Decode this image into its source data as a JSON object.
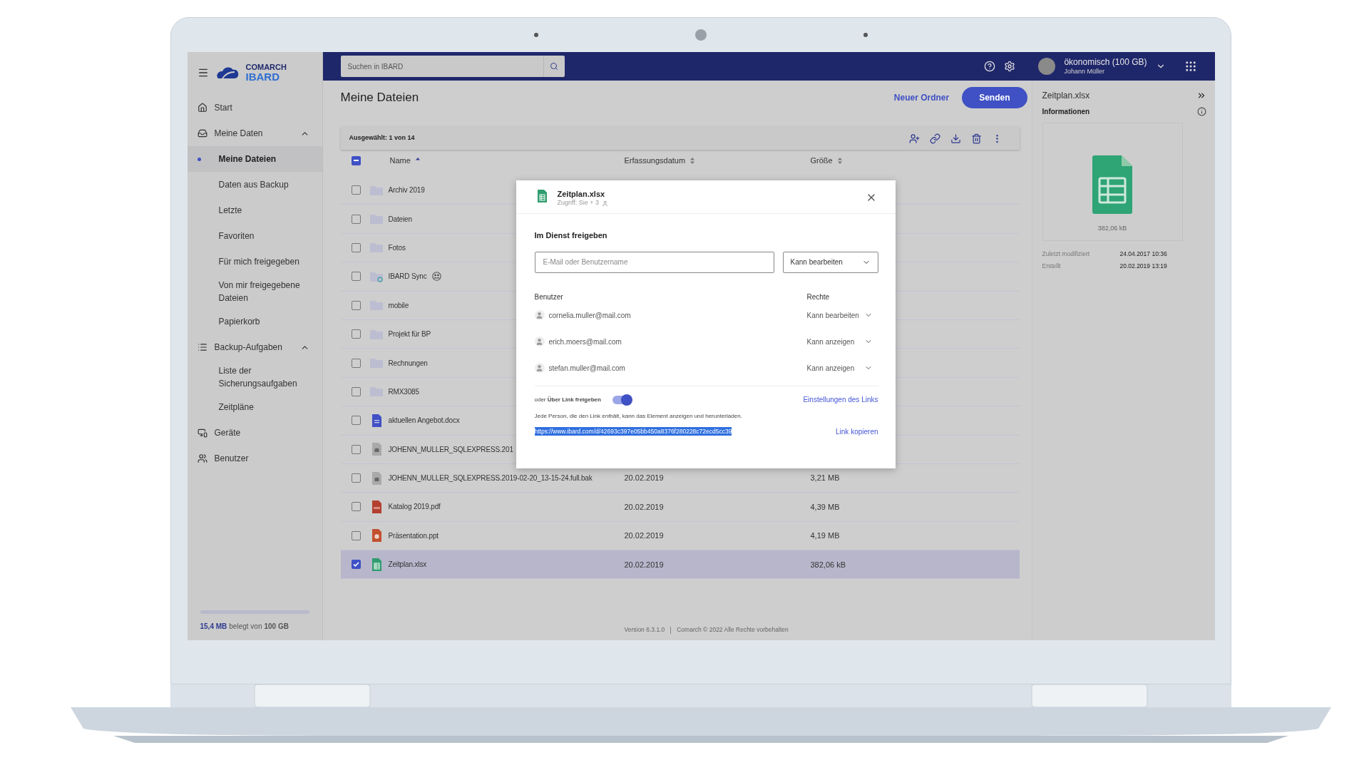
{
  "sidebar": {
    "logo_top": "COMARCH",
    "logo_bottom": "IBARD",
    "items": [
      {
        "kind": "link",
        "label": "Start"
      },
      {
        "kind": "group",
        "label": "Meine Daten",
        "expanded": true,
        "children": [
          {
            "label": "Meine Dateien",
            "selected": true
          },
          {
            "label": "Daten aus Backup",
            "selected": false
          },
          {
            "label": "Letzte",
            "selected": false
          },
          {
            "label": "Favoriten",
            "selected": false
          },
          {
            "label": "Für mich freigegeben",
            "selected": false
          },
          {
            "label": "Von mir freigegebene Dateien",
            "selected": false
          },
          {
            "label": "Papierkorb",
            "selected": false
          }
        ]
      },
      {
        "kind": "group",
        "label": "Backup-Aufgaben",
        "expanded": true,
        "children": [
          {
            "label": "Liste der Sicherungsaufgaben",
            "selected": false
          },
          {
            "label": "Zeitpläne",
            "selected": false
          }
        ]
      },
      {
        "kind": "link",
        "label": "Geräte"
      },
      {
        "kind": "link",
        "label": "Benutzer"
      }
    ],
    "storage": {
      "used": "15,4 MB",
      "text": "belegt von",
      "total": "100 GB"
    }
  },
  "topbar": {
    "search_placeholder": "Suchen in IBARD",
    "plan": "ökonomisch (100 GB)",
    "user": "Johann Müller"
  },
  "header": {
    "title": "Meine Dateien",
    "buttons": [
      {
        "label": "Neuer Ordner",
        "kind": "text"
      },
      {
        "label": "Senden",
        "kind": "primary"
      }
    ]
  },
  "toolbar": {
    "selection": "Ausgewählt: 1 von 14",
    "select_all_indeterminate": true
  },
  "table": {
    "columns": [
      {
        "label": "Name",
        "sorted": true
      },
      {
        "label": "Erfassungsdatum",
        "sorted": false
      },
      {
        "label": "Größe",
        "sorted": false
      }
    ],
    "rows": [
      {
        "kind": "folder",
        "name": "Archiv 2019",
        "selected": false
      },
      {
        "kind": "folder",
        "name": "Dateien",
        "selected": false
      },
      {
        "kind": "folder",
        "name": "Fotos",
        "selected": false
      },
      {
        "kind": "sync-folder",
        "name": "IBARD Sync",
        "selected": false
      },
      {
        "kind": "folder",
        "name": "mobile",
        "selected": false
      },
      {
        "kind": "folder",
        "name": "Projekt für BP",
        "selected": false
      },
      {
        "kind": "folder",
        "name": "Rechnungen",
        "selected": false
      },
      {
        "kind": "folder",
        "name": "RMX3085",
        "selected": false
      },
      {
        "kind": "doc",
        "name": "aktuellen Angebot.docx",
        "selected": false
      },
      {
        "kind": "bak",
        "name": "JOHENN_MULLER_SQLEXPRESS.201",
        "selected": false
      },
      {
        "kind": "bak",
        "name": "JOHENN_MULLER_SQLEXPRESS.2019-02-20_13-15-24.full.bak",
        "date": "20.02.2019",
        "size": "3,21 MB",
        "selected": false
      },
      {
        "kind": "pdf",
        "name": "Katalog 2019.pdf",
        "date": "20.02.2019",
        "size": "4,39 MB",
        "selected": false
      },
      {
        "kind": "ppt",
        "name": "Präsentation.ppt",
        "date": "20.02.2019",
        "size": "4,19 MB",
        "selected": false
      },
      {
        "kind": "xlsx",
        "name": "Zeitplan.xlsx",
        "date": "20.02.2019",
        "size": "382,06 kB",
        "selected": true
      }
    ]
  },
  "footer": {
    "version": "Version 6.3.1.0",
    "copyright": "Comarch © 2022 Alle Rechte vorbehalten"
  },
  "details": {
    "title": "Zeitplan.xlsx",
    "section": "Informationen",
    "size": "382,06 kB",
    "meta": [
      {
        "label": "Zuletzt modifiziert",
        "value": "24.04.2017 10:36"
      },
      {
        "label": "Erstellt",
        "value": "20.02.2019 13:19"
      }
    ]
  },
  "dialog": {
    "file": "Zeitplan.xlsx",
    "access": "Zugriff: Sie + 3",
    "heading": "Im Dienst freigeben",
    "email_placeholder": "E-Mail oder Benutzername",
    "role": "Kann bearbeiten",
    "users_label": "Benutzer",
    "rights_label": "Rechte",
    "users": [
      {
        "email": "cornelia.muller@mail.com",
        "right": "Kann bearbeiten"
      },
      {
        "email": "erich.moers@mail.com",
        "right": "Kann anzeigen"
      },
      {
        "email": "stefan.muller@mail.com",
        "right": "Kann anzeigen"
      }
    ],
    "link_sharing": {
      "label": "oder **Über Link freigeben**",
      "on": true,
      "settings": "Einstellungen des Links",
      "note": "Jede Person, die den Link enthält, kann das Element anzeigen und herunterladen.",
      "url": "https://www.ibard.com/d/42693c397e05bb450a8376f280228c72ecd5cc39",
      "url_selected": true,
      "copy": "Link kopieren"
    }
  }
}
